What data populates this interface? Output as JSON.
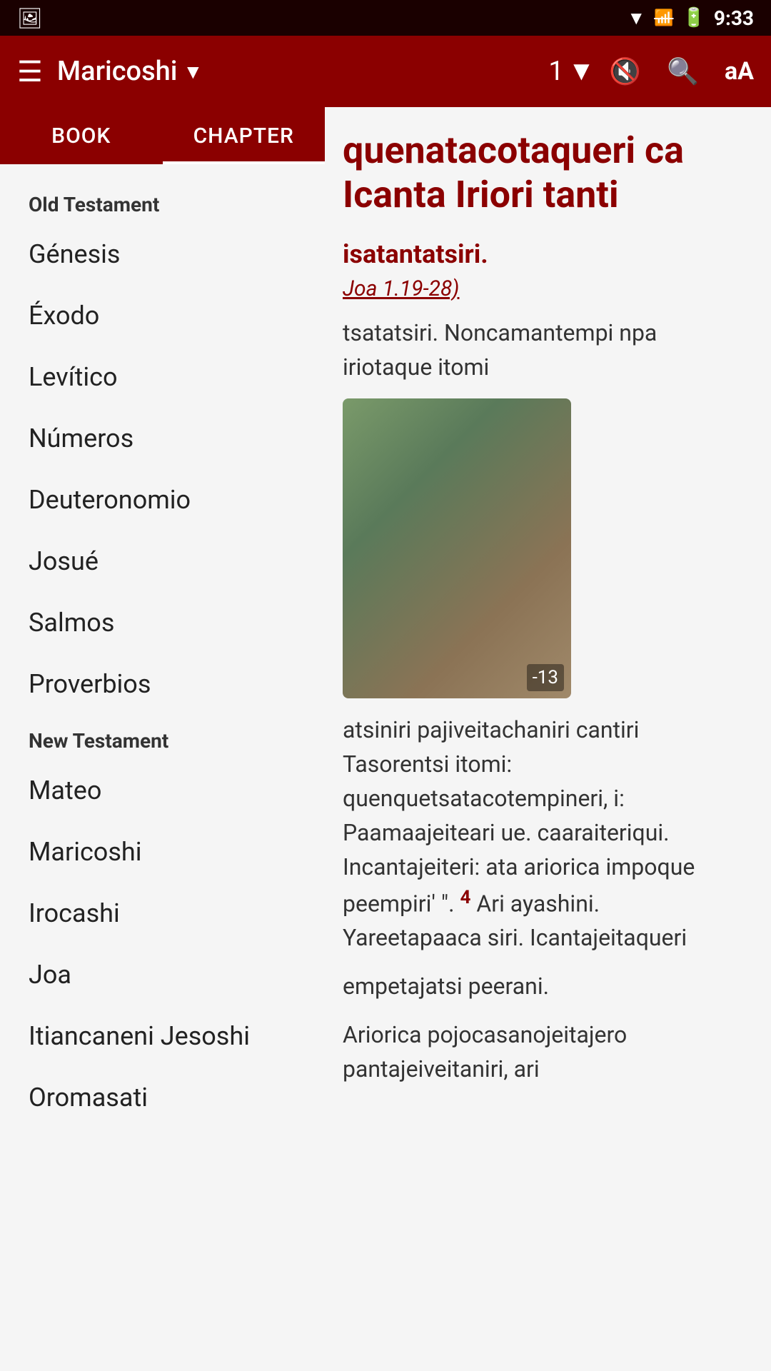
{
  "statusBar": {
    "time": "9:33",
    "icons": [
      "wifi",
      "signal-off",
      "battery"
    ]
  },
  "toolbar": {
    "menuIcon": "☰",
    "title": "Maricoshi",
    "titleArrow": "▼",
    "chapter": "1",
    "chapterArrow": "▼",
    "muteIcon": "🔇",
    "searchIcon": "🔍",
    "fontIcon": "aA"
  },
  "tabs": [
    {
      "id": "book",
      "label": "BOOK",
      "active": false
    },
    {
      "id": "chapter",
      "label": "CHAPTER",
      "active": true
    }
  ],
  "sidebar": {
    "oldTestament": {
      "header": "Old Testament",
      "books": [
        "Génesis",
        "Éxodo",
        "Levítico",
        "Números",
        "Deuteronomio",
        "Josué",
        "Salmos",
        "Proverbios"
      ]
    },
    "newTestament": {
      "header": "New Testament",
      "books": [
        "Mateo",
        "Maricoshi",
        "Irocashi",
        "Joa",
        "Itiancaneni Jesoshi",
        "Oromasati"
      ]
    }
  },
  "mainContent": {
    "title": "quenatacotaqueri ca Icanta Iriori tanti",
    "subtitle": "isatantatsiri.",
    "reference": "Joa 1.19-28)",
    "textBefore": "tsatatsiri. Noncamantempi npa iriotaque itomi",
    "imageCaption": "-13",
    "textAfter": "atsiniri pajiveitachaniri cantiri Tasorentsi itomi: quenquetsatacotempineri, i: Paamaajeiteari ue. caaraiteriqui. Incantajeiteri: ata ariorica impoque peempiri' \".",
    "verseNumber": "4",
    "textContinued": "Ari ayashini. Yareetapaaca siri. Icantajeitaqueri",
    "textFinal": "empetajatsi peerani.",
    "textBottom": "Ariorica pojocasanojeitajero pantajeiveitaniri, ari"
  }
}
